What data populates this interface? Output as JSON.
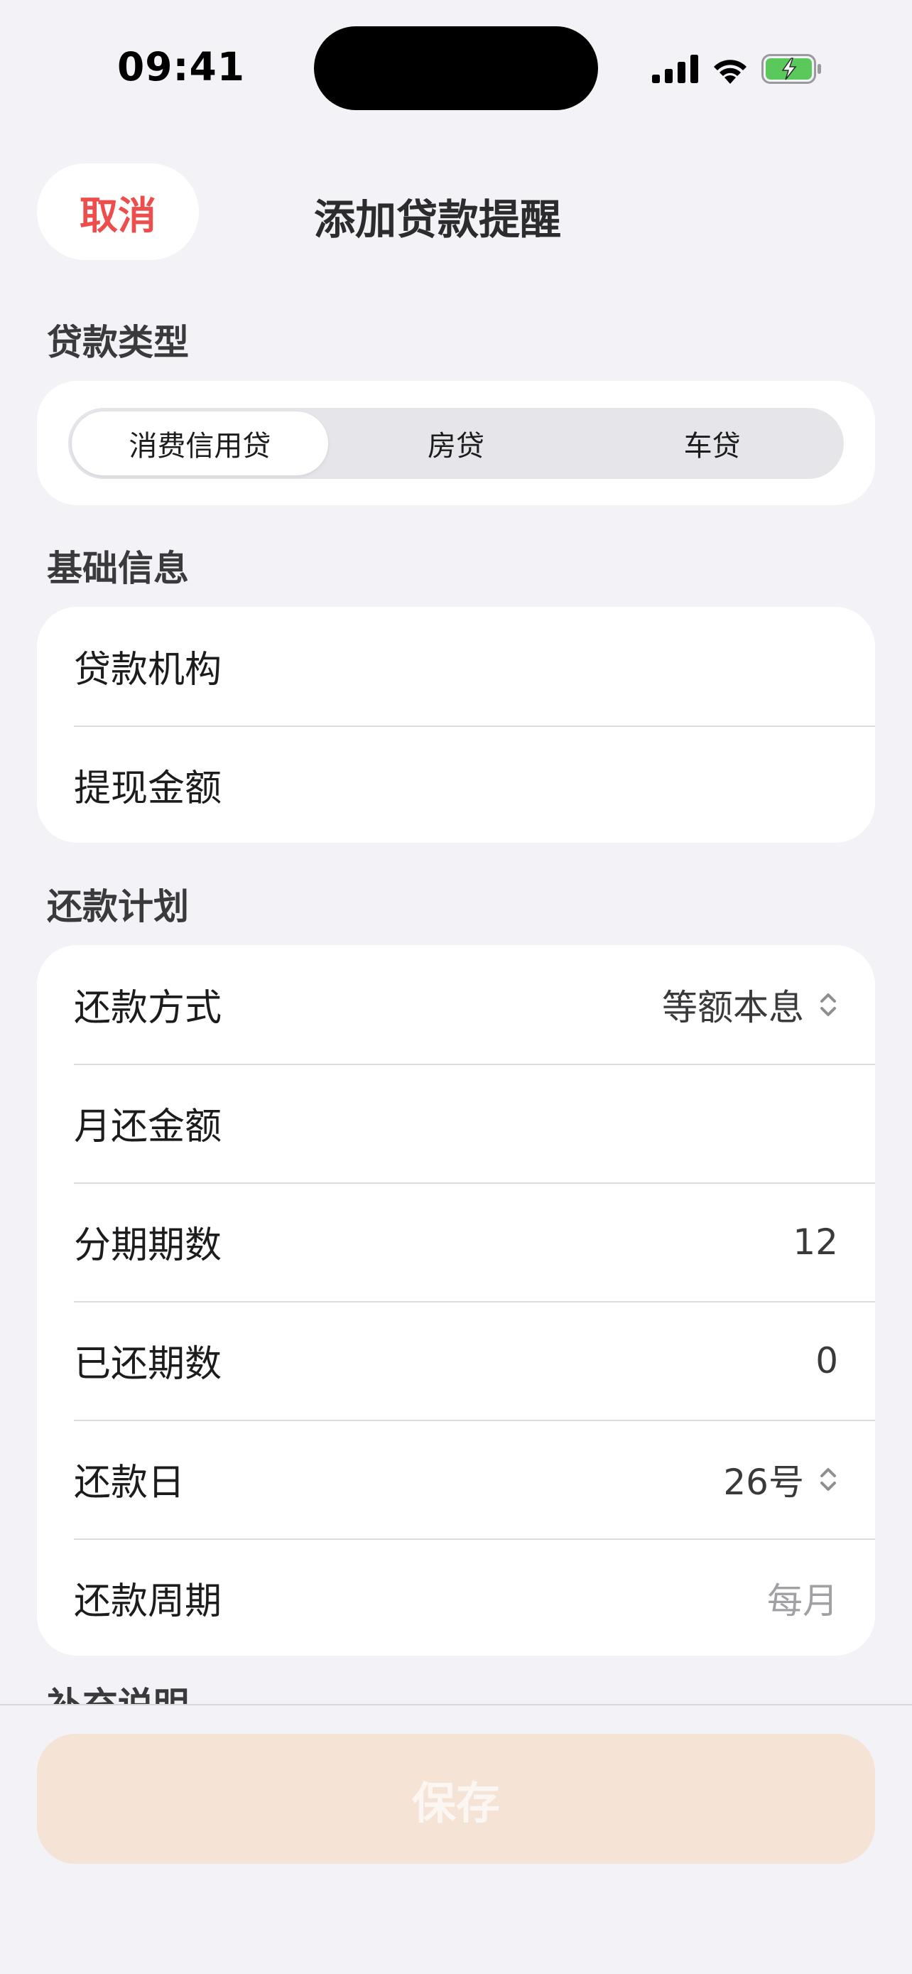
{
  "status_bar": {
    "time": "09:41"
  },
  "header": {
    "cancel_label": "取消",
    "title": "添加贷款提醒"
  },
  "loan_type": {
    "section_label": "贷款类型",
    "options": [
      "消费信用贷",
      "房贷",
      "车贷"
    ],
    "selected": "消费信用贷"
  },
  "basic_info": {
    "section_label": "基础信息",
    "rows": [
      {
        "label": "贷款机构",
        "value": ""
      },
      {
        "label": "提现金额",
        "value": ""
      }
    ]
  },
  "repayment_plan": {
    "section_label": "还款计划",
    "method": {
      "label": "还款方式",
      "value": "等额本息"
    },
    "monthly_amount": {
      "label": "月还金额",
      "value": ""
    },
    "installments": {
      "label": "分期期数",
      "value": "12"
    },
    "paid_installments": {
      "label": "已还期数",
      "value": "0"
    },
    "due_day": {
      "label": "还款日",
      "value": "26号"
    },
    "cycle": {
      "label": "还款周期",
      "value": "每月"
    }
  },
  "notes": {
    "section_label": "补充说明"
  },
  "footer": {
    "save_label": "保存"
  },
  "colors": {
    "background": "#f2f2f7",
    "cancel_text": "#ee4d4d",
    "save_button_bg": "#f5e3d6",
    "battery_green": "#5ac85a"
  },
  "icons": [
    "signal-icon",
    "wifi-icon",
    "battery-charging-icon",
    "chevron-updown-icon"
  ]
}
